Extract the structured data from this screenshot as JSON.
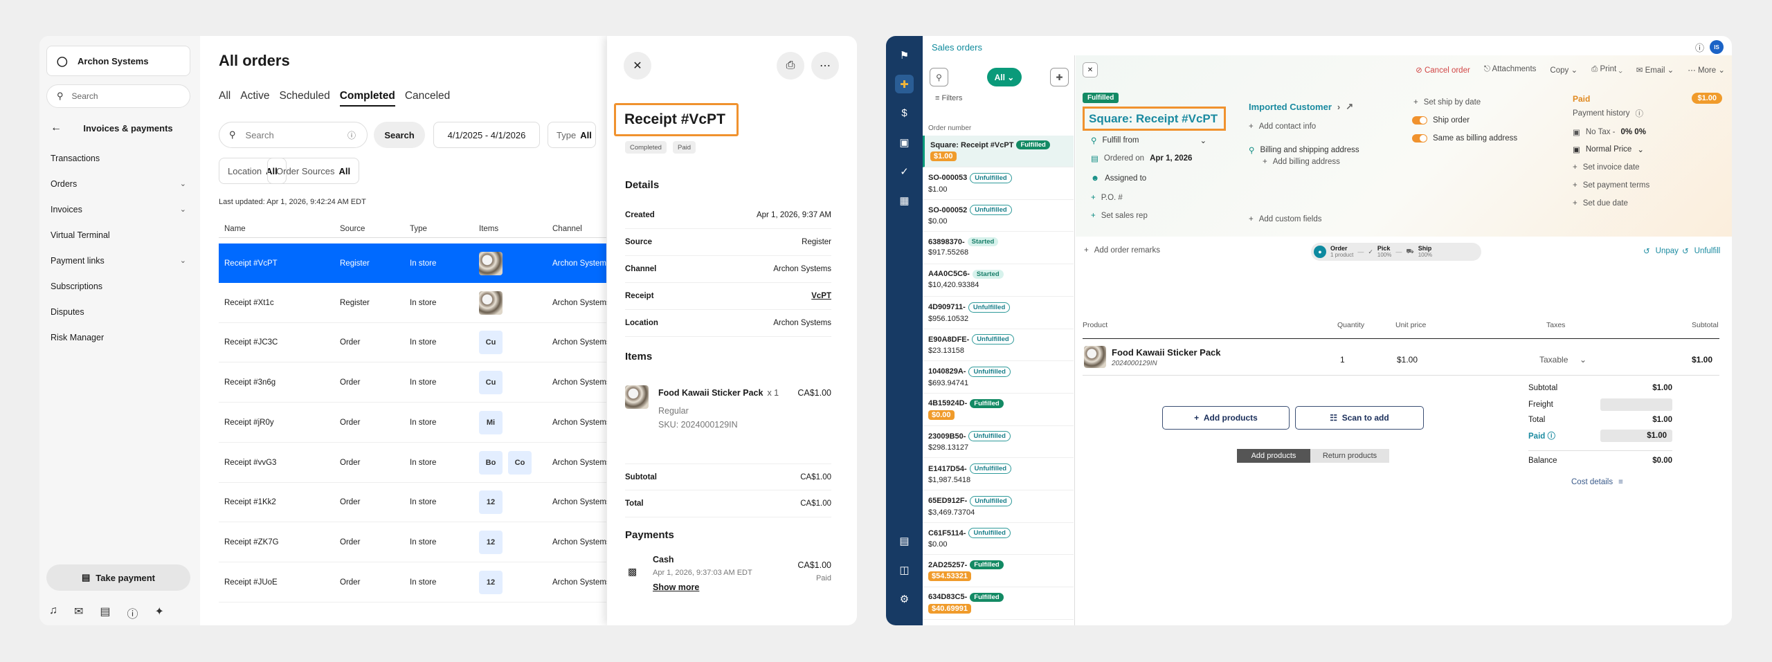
{
  "left": {
    "merchant": "Archon Systems",
    "search_placeholder": "Search",
    "section": "Invoices & payments",
    "nav": [
      "Transactions",
      "Orders",
      "Invoices",
      "Virtual Terminal",
      "Payment links",
      "Subscriptions",
      "Disputes",
      "Risk Manager"
    ],
    "take_payment": "Take payment",
    "title": "All orders",
    "tabs": [
      "All",
      "Active",
      "Scheduled",
      "Completed",
      "Canceled"
    ],
    "search_btn": "Search",
    "date_range": "4/1/2025 - 4/1/2026",
    "type_label": "Type",
    "type_value": "All",
    "location_label": "Location",
    "location_value": "All",
    "sources_label": "Order Sources",
    "sources_value": "All",
    "last_updated": "Last updated: Apr 1, 2026, 9:42:24 AM EDT",
    "columns": [
      "Name",
      "Source",
      "Type",
      "Items",
      "Channel"
    ],
    "rows": [
      {
        "name": "Receipt #VcPT",
        "source": "Register",
        "type": "In store",
        "items": [
          "img"
        ],
        "channel": "Archon Systems"
      },
      {
        "name": "Receipt #Xt1c",
        "source": "Register",
        "type": "In store",
        "items": [
          "img"
        ],
        "channel": "Archon Systems"
      },
      {
        "name": "Receipt #JC3C",
        "source": "Order",
        "type": "In store",
        "items": [
          "Cu"
        ],
        "channel": "Archon Systems"
      },
      {
        "name": "Receipt #3n6g",
        "source": "Order",
        "type": "In store",
        "items": [
          "Cu"
        ],
        "channel": "Archon Systems"
      },
      {
        "name": "Receipt #jR0y",
        "source": "Order",
        "type": "In store",
        "items": [
          "Mi"
        ],
        "channel": "Archon Systems"
      },
      {
        "name": "Receipt #vvG3",
        "source": "Order",
        "type": "In store",
        "items": [
          "Bo",
          "Co"
        ],
        "channel": "Archon Systems"
      },
      {
        "name": "Receipt #1Kk2",
        "source": "Order",
        "type": "In store",
        "items": [
          "12"
        ],
        "channel": "Archon Systems"
      },
      {
        "name": "Receipt #ZK7G",
        "source": "Order",
        "type": "In store",
        "items": [
          "12"
        ],
        "channel": "Archon Systems"
      },
      {
        "name": "Receipt #JUoE",
        "source": "Order",
        "type": "In store",
        "items": [
          "12"
        ],
        "channel": "Archon Systems"
      }
    ],
    "detail": {
      "title": "Receipt #VcPT",
      "badges": [
        "Completed",
        "Paid"
      ],
      "details_h": "Details",
      "details": [
        [
          "Created",
          "Apr 1, 2026, 9:37 AM"
        ],
        [
          "Source",
          "Register"
        ],
        [
          "Channel",
          "Archon Systems"
        ],
        [
          "Receipt",
          "VcPT"
        ],
        [
          "Location",
          "Archon Systems"
        ]
      ],
      "items_h": "Items",
      "item_name": "Food Kawaii Sticker Pack",
      "item_qty": "x 1",
      "item_price": "CA$1.00",
      "item_variant": "Regular",
      "item_sku": "SKU: 2024000129IN",
      "subtotal_l": "Subtotal",
      "subtotal_v": "CA$1.00",
      "total_l": "Total",
      "total_v": "CA$1.00",
      "payments_h": "Payments",
      "pay_name": "Cash",
      "pay_date": "Apr 1, 2026, 9:37:03 AM EDT",
      "pay_amount": "CA$1.00",
      "pay_status": "Paid",
      "show_more": "Show more"
    }
  },
  "right": {
    "app_title": "Sales orders",
    "avatar": "IS",
    "all_pill": "All",
    "filters": "Filters",
    "order_number_h": "Order number",
    "orders": [
      {
        "n": "Square: Receipt #VcPT",
        "tag": "Fulfilled",
        "t": "f",
        "amt": "$1.00",
        "hl": true
      },
      {
        "n": "SO-000053",
        "tag": "Unfulfilled",
        "t": "u",
        "amt": "$1.00"
      },
      {
        "n": "SO-000052",
        "tag": "Unfulfilled",
        "t": "u",
        "amt": "$0.00"
      },
      {
        "n": "63898370-",
        "tag": "Started",
        "t": "s",
        "amt": "$917.55268"
      },
      {
        "n": "A4A0C5C6-",
        "tag": "Started",
        "t": "s",
        "amt": "$10,420.93384"
      },
      {
        "n": "4D909711-",
        "tag": "Unfulfilled",
        "t": "u",
        "amt": "$956.10532"
      },
      {
        "n": "E90A8DFE-",
        "tag": "Unfulfilled",
        "t": "u",
        "amt": "$23.13158"
      },
      {
        "n": "1040829A-",
        "tag": "Unfulfilled",
        "t": "u",
        "amt": "$693.94741"
      },
      {
        "n": "4B15924D-",
        "tag": "Fulfilled",
        "t": "f",
        "amt": "$0.00",
        "hl": true
      },
      {
        "n": "23009B50-",
        "tag": "Unfulfilled",
        "t": "u",
        "amt": "$298.13127"
      },
      {
        "n": "E1417D54-",
        "tag": "Unfulfilled",
        "t": "u",
        "amt": "$1,987.5418"
      },
      {
        "n": "65ED912F-",
        "tag": "Unfulfilled",
        "t": "u",
        "amt": "$3,469.73704"
      },
      {
        "n": "C61F5114-",
        "tag": "Unfulfilled",
        "t": "u",
        "amt": "$0.00"
      },
      {
        "n": "2AD25257-",
        "tag": "Fulfilled",
        "t": "f",
        "amt": "$54.53321",
        "hl": true
      },
      {
        "n": "634D83C5-",
        "tag": "Fulfilled",
        "t": "f",
        "amt": "$40.69991",
        "hl": true
      }
    ],
    "tools": [
      "Cancel order",
      "Attachments",
      "Copy",
      "Print",
      "Email",
      "More"
    ],
    "status": "Fulfilled",
    "title": "Square: Receipt #VcPT",
    "fulfill_from": "Fulfill from",
    "ordered_on": "Ordered on",
    "ordered_date": "Apr 1, 2026",
    "assigned_to": "Assigned to",
    "po": "P.O. #",
    "sales_rep": "Set sales rep",
    "customer": "Imported Customer",
    "add_contact": "Add contact info",
    "billing": "Billing and shipping address",
    "add_billing": "Add billing address",
    "custom_fields": "Add custom fields",
    "ship_by": "Set ship by date",
    "ship_order": "Ship order",
    "same_billing": "Same as billing address",
    "paid": "Paid",
    "paid_amt": "$1.00",
    "payment_history": "Payment history",
    "no_tax": "No Tax -",
    "no_tax_rate": "0% 0%",
    "normal_price": "Normal Price",
    "invoice_date": "Set invoice date",
    "payment_terms": "Set payment terms",
    "due_date": "Set due date",
    "order_remarks": "Add order remarks",
    "steps": [
      {
        "l": "Order",
        "s": "1 product"
      },
      {
        "l": "Pick",
        "s": "100%"
      },
      {
        "l": "Ship",
        "s": "100%"
      }
    ],
    "unpay": "Unpay",
    "unfulfill": "Unfulfill",
    "cols": [
      "Product",
      "Quantity",
      "Unit price",
      "Taxes",
      "Subtotal"
    ],
    "product_name": "Food Kawaii Sticker Pack",
    "product_sku": "2024000129IN",
    "qty": "1",
    "unit_price": "$1.00",
    "tax": "Taxable",
    "line_subtotal": "$1.00",
    "add_products": "Add products",
    "scan": "Scan to add",
    "seg": [
      "Add products",
      "Return products"
    ],
    "totals": {
      "subtotal_l": "Subtotal",
      "subtotal": "$1.00",
      "freight_l": "Freight",
      "total_l": "Total",
      "total": "$1.00",
      "paid_l": "Paid",
      "paid": "$1.00",
      "balance_l": "Balance",
      "balance": "$0.00"
    },
    "cost_details": "Cost details"
  }
}
